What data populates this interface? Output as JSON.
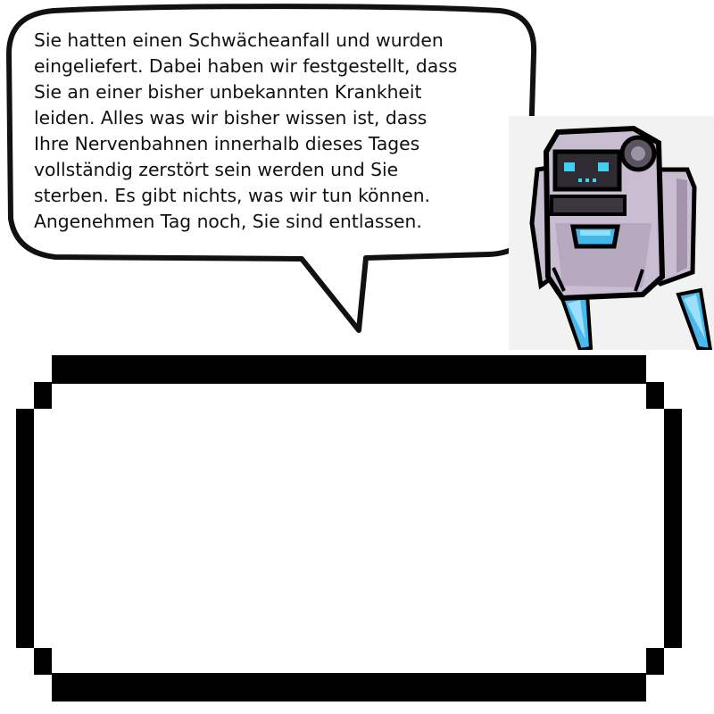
{
  "speech_bubble": {
    "lines": [
      "Sie hatten einen Schwächeanfall und wurden",
      "eingeliefert. Dabei haben wir festgestellt, dass",
      "Sie an einer bisher unbekannten Krankheit",
      "leiden. Alles was wir bisher wissen ist, dass",
      "Ihre Nervenbahnen innerhalb dieses Tages",
      "vollständig zerstört sein werden und Sie",
      "sterben. Es gibt nichts, was wir tun können.",
      "Angenehmen Tag noch, Sie sind entlassen."
    ]
  },
  "dialog_box": {
    "text": ""
  },
  "character": {
    "icon": "robot-doctor-icon"
  },
  "colors": {
    "outline": "#000000",
    "robot_body": "#c9bdd2",
    "robot_shadow": "#a493ad",
    "robot_visor": "#2e2b33",
    "robot_eyes": "#3fd2f0",
    "robot_mouth": "#45b6e8",
    "thruster": "#4ab8ea"
  }
}
